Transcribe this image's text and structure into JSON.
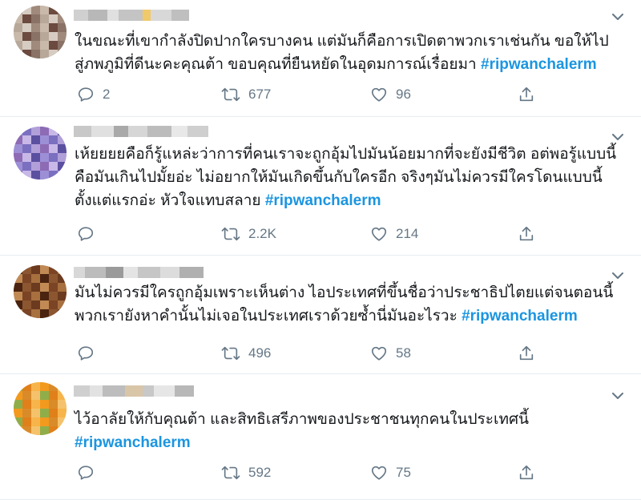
{
  "tweets": [
    {
      "avatar_colors": [
        "#b7a89a",
        "#8a7266",
        "#6b4a3f",
        "#c9b9ab",
        "#a08a7c",
        "#d7ccc2"
      ],
      "name_blocks": [
        "#d0d0d0",
        "#b8b8b8",
        "#e0e0e0",
        "#c4c4c4",
        "#f0c96a",
        "#d8d8d8",
        "#bfbfbf"
      ],
      "text_plain": "ในขณะที่เขากำลังปิดปากใครบางคน แต่มันก็คือการเปิดตาพวกเราเช่นกัน ขอให้ไปสู่ภพภูมิที่ดีนะคะคุณต้า ขอบคุณที่ยืนหยัดในอุดมการณ์เรื่อยมา",
      "hashtag": "#ripwanchalerm",
      "reply_count": "2",
      "retweet_count": "677",
      "like_count": "96"
    },
    {
      "avatar_colors": [
        "#7b6fc0",
        "#9c8fd6",
        "#5b4fa0",
        "#c7b8e8",
        "#8e6bb5",
        "#b19fd9"
      ],
      "name_blocks": [
        "#c8c8c8",
        "#e0e0e0",
        "#a9a9a9",
        "#d6d6d6",
        "#bcbcbc",
        "#e8e8e8",
        "#cfcfcf"
      ],
      "text_plain": "เห้ยยยยคือก็รู้แหล่ะว่าการที่คนเราจะถูกอุ้มไปมันน้อยมากที่จะยังมีชีวิต อต่พอรู้แบบนี้คือมันเกินไปมั้ยอ่ะ ไม่อยากให้มันเกิดขึ้นกับใครอีก จริงๆมันไม่ควรมีใครโดนแบบนี้ตั้งแต่แรกอ่ะ หัวใจแทบสลาย",
      "hashtag": "#ripwanchalerm",
      "reply_count": "",
      "retweet_count": "2.2K",
      "like_count": "214"
    },
    {
      "avatar_colors": [
        "#6b3a1f",
        "#8c5630",
        "#4a2410",
        "#a8703f",
        "#7a4425",
        "#c18a55"
      ],
      "name_blocks": [
        "#d8d8d8",
        "#bcbcbc",
        "#9a9a9a",
        "#e4e4e4",
        "#c6c6c6",
        "#dcdcdc",
        "#b0b0b0"
      ],
      "text_plain": "มันไม่ควรมีใครถูกอุ้มเพราะเห็นต่าง ไอประเทศที่ขึ้นชื่อว่าประชาธิปไตยแต่จนตอนนี้พวกเรายังหาคำนั้นไม่เจอในประเทศเราด้วยซ้ำนี่มันอะไรวะ",
      "hashtag": "#ripwanchalerm",
      "reply_count": "",
      "retweet_count": "496",
      "like_count": "58"
    },
    {
      "avatar_colors": [
        "#f29a1e",
        "#f7b44a",
        "#e0801a",
        "#8fae4a",
        "#f5c26b",
        "#d98b2a"
      ],
      "name_blocks": [
        "#cfcfcf",
        "#e2e2e2",
        "#bdbdbd",
        "#d9c6a8",
        "#c8c8c8",
        "#e6e6e6",
        "#b8b8b8"
      ],
      "text_plain": "ไว้อาลัยให้กับคุณต้า และสิทธิเสรีภาพของประชาชนทุกคนในประเทศนี้",
      "hashtag": "#ripwanchalerm",
      "reply_count": "",
      "retweet_count": "592",
      "like_count": "75"
    }
  ],
  "colors": {
    "hashtag": "#1b95e0",
    "icon": "#657786",
    "divider": "#e6ecf0"
  },
  "icons": {
    "reply": "reply-icon",
    "retweet": "retweet-icon",
    "like": "heart-icon",
    "share": "share-icon",
    "more": "chevron-down-icon"
  }
}
